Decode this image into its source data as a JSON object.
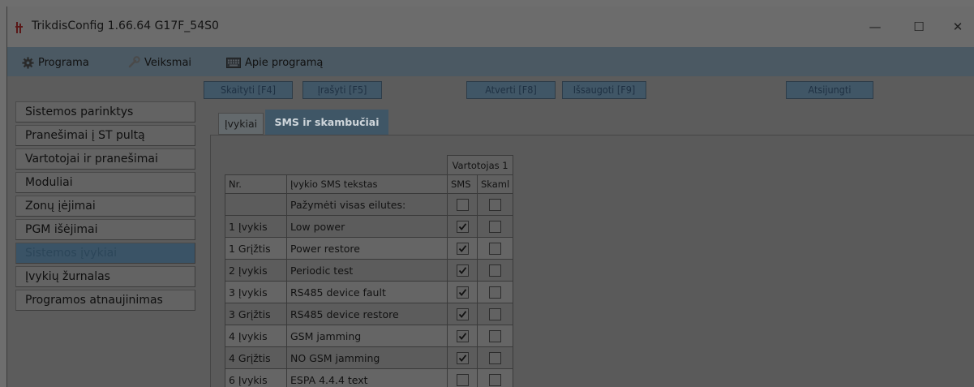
{
  "window": {
    "title": "TrikdisConfig 1.66.64   G17F_54S0",
    "controls": {
      "minimize": "—",
      "maximize": "☐",
      "close": "✕"
    }
  },
  "menu": [
    {
      "label": "Programa",
      "icon": "gear-icon"
    },
    {
      "label": "Veiksmai",
      "icon": "wrench-icon"
    },
    {
      "label": "Apie programą",
      "icon": "keyboard-icon"
    }
  ],
  "toolbar": {
    "read": "Skaityti [F4]",
    "write": "Įrašyti [F5]",
    "open": "Atverti [F8]",
    "save": "Išsaugoti [F9]",
    "disconnect": "Atsijungti"
  },
  "sidebar": {
    "items": [
      {
        "label": "Sistemos parinktys",
        "active": false
      },
      {
        "label": "Pranešimai į ST pultą",
        "active": false
      },
      {
        "label": "Vartotojai ir pranešimai",
        "active": false
      },
      {
        "label": "Moduliai",
        "active": false
      },
      {
        "label": "Zonų įėjimai",
        "active": false
      },
      {
        "label": "PGM išėjimai",
        "active": false
      },
      {
        "label": "Sistemos įvykiai",
        "active": true
      },
      {
        "label": "Įvykių žurnalas",
        "active": false
      },
      {
        "label": "Programos atnaujinimas",
        "active": false
      }
    ]
  },
  "tabs": [
    {
      "label": "Įvykiai",
      "active": false
    },
    {
      "label": "SMS ir skambučiai",
      "active": true
    }
  ],
  "table": {
    "group_header": "Vartotojas 1",
    "columns": [
      "Nr.",
      "Įvykio SMS tekstas",
      "SMS",
      "Skaml"
    ],
    "select_all_label": "Pažymėti visas eilutes:",
    "select_all": {
      "sms": false,
      "call": false
    },
    "rows": [
      {
        "nr": "1 Įvykis",
        "text": "Low power",
        "sms": true,
        "call": false
      },
      {
        "nr": "1 Grįžtis",
        "text": "Power restore",
        "sms": true,
        "call": false
      },
      {
        "nr": "2 Įvykis",
        "text": "Periodic test",
        "sms": true,
        "call": false
      },
      {
        "nr": "3 Įvykis",
        "text": "RS485 device fault",
        "sms": true,
        "call": false
      },
      {
        "nr": "3 Grįžtis",
        "text": "RS485 device restore",
        "sms": true,
        "call": false
      },
      {
        "nr": "4 Įvykis",
        "text": "GSM jamming",
        "sms": true,
        "call": false
      },
      {
        "nr": "4 Grįžtis",
        "text": "NO GSM jamming",
        "sms": true,
        "call": false
      },
      {
        "nr": "6 Įvykis",
        "text": "ESPA 4.4.4 text",
        "sms": false,
        "call": false
      }
    ]
  },
  "colors": {
    "accent": "#3f5666",
    "menubar": "#4b5963"
  }
}
